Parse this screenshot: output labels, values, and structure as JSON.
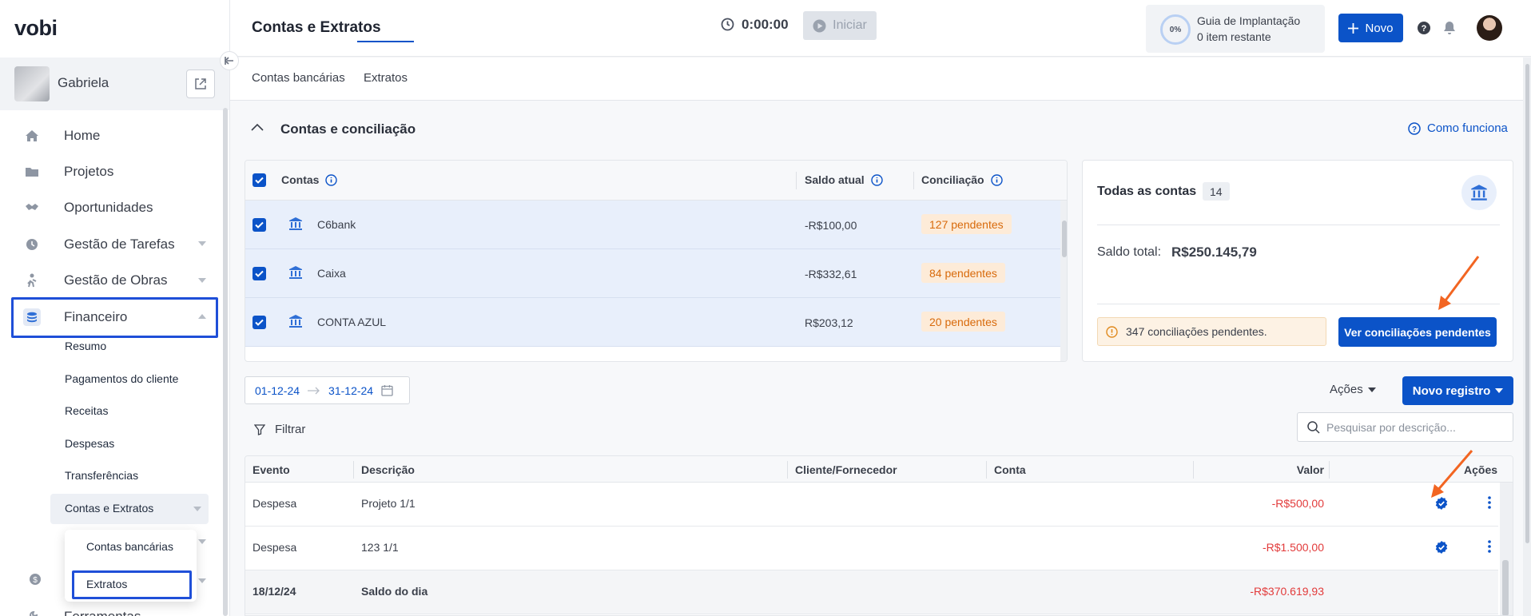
{
  "app": {
    "logo": "vobi",
    "page_title": "Contas e Extratos"
  },
  "company": {
    "name": "Gabriela"
  },
  "sidebar": {
    "items": [
      {
        "label": "Home",
        "icon": "home-icon"
      },
      {
        "label": "Projetos",
        "icon": "folder-icon"
      },
      {
        "label": "Oportunidades",
        "icon": "handshake-icon"
      },
      {
        "label": "Gestão de Tarefas",
        "icon": "clock-icon"
      },
      {
        "label": "Gestão de Obras",
        "icon": "worker-icon"
      },
      {
        "label": "Financeiro",
        "icon": "coins-icon"
      },
      {
        "label": "Ferramentas",
        "icon": "tools-icon"
      }
    ],
    "financeiro_sub": [
      "Resumo",
      "Pagamentos do cliente",
      "Receitas",
      "Despesas",
      "Transferências",
      "Contas e Extratos"
    ],
    "popover": [
      "Contas bancárias",
      "Extratos"
    ]
  },
  "topbar": {
    "timer": "0:00:00",
    "start_label": "Iniciar",
    "guide_percent": "0%",
    "guide_title": "Guia de Implantação",
    "guide_sub": "0 item restante",
    "new_label": "Novo"
  },
  "tabs": [
    "Contas bancárias",
    "Extratos"
  ],
  "section": {
    "title": "Contas e conciliação",
    "help_link": "Como funciona"
  },
  "accounts": {
    "headers": {
      "account": "Contas",
      "balance": "Saldo atual",
      "reconciliation": "Conciliação"
    },
    "rows": [
      {
        "name": "C6bank",
        "balance": "-R$100,00",
        "pending": "127 pendentes"
      },
      {
        "name": "Caixa",
        "balance": "-R$332,61",
        "pending": "84 pendentes"
      },
      {
        "name": "CONTA AZUL",
        "balance": "R$203,12",
        "pending": "20 pendentes"
      }
    ]
  },
  "summary": {
    "title": "Todas as contas",
    "count": "14",
    "total_label": "Saldo total:",
    "total_value": "R$250.145,79",
    "alert": "347 conciliações pendentes.",
    "button": "Ver conciliações pendentes"
  },
  "filters": {
    "date_from": "01-12-24",
    "date_to": "31-12-24",
    "actions_label": "Ações",
    "new_record_label": "Novo registro",
    "filter_label": "Filtrar",
    "search_placeholder": "Pesquisar por descrição..."
  },
  "transactions": {
    "headers": {
      "event": "Evento",
      "description": "Descrição",
      "client": "Cliente/Fornecedor",
      "account": "Conta",
      "value": "Valor",
      "actions": "Ações"
    },
    "rows": [
      {
        "event": "Despesa",
        "description": "Projeto 1/1",
        "value": "-R$500,00"
      },
      {
        "event": "Despesa",
        "description": "123 1/1",
        "value": "-R$1.500,00"
      }
    ],
    "day_balance": {
      "date": "18/12/24",
      "label": "Saldo do dia",
      "value": "-R$370.619,93"
    }
  },
  "colors": {
    "accent": "#0b53c8",
    "negative": "#e23b3b",
    "pending_text": "#d86a0b",
    "annotation_arrow": "#f26522",
    "highlight_box": "#1f4fd8"
  }
}
